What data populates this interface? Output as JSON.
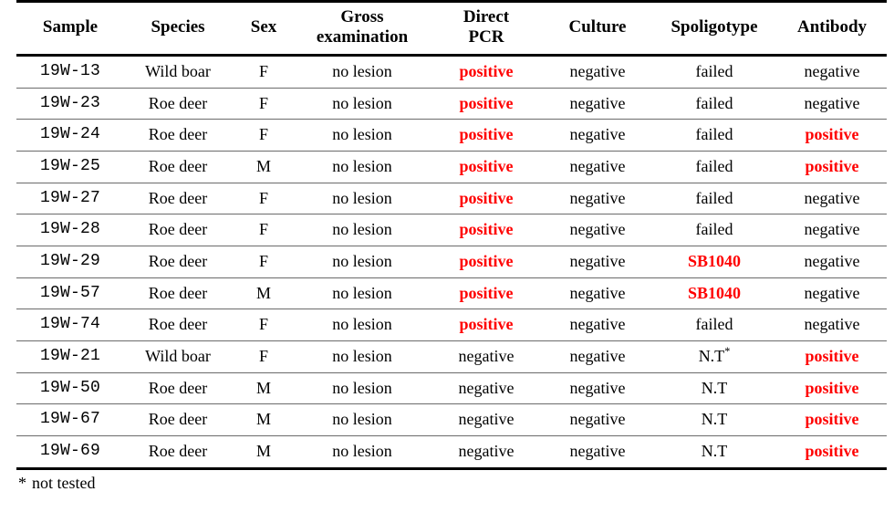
{
  "table": {
    "columns": [
      {
        "key": "sample",
        "label": "Sample",
        "label_line1": "Sample",
        "label_line2": ""
      },
      {
        "key": "species",
        "label": "Species",
        "label_line1": "Species",
        "label_line2": ""
      },
      {
        "key": "sex",
        "label": "Sex",
        "label_line1": "Sex",
        "label_line2": ""
      },
      {
        "key": "gross",
        "label": "Gross examination",
        "label_line1": "Gross",
        "label_line2": "examination"
      },
      {
        "key": "pcr",
        "label": "Direct PCR",
        "label_line1": "Direct",
        "label_line2": "PCR"
      },
      {
        "key": "culture",
        "label": "Culture",
        "label_line1": "Culture",
        "label_line2": ""
      },
      {
        "key": "spoligotype",
        "label": "Spoligotype",
        "label_line1": "Spoligotype",
        "label_line2": ""
      },
      {
        "key": "antibody",
        "label": "Antibody",
        "label_line1": "Antibody",
        "label_line2": ""
      }
    ],
    "rows": [
      {
        "sample": "19W-13",
        "species": "Wild boar",
        "sex": "F",
        "gross": "no lesion",
        "pcr": "positive",
        "culture": "negative",
        "spoligotype": "failed",
        "antibody": "negative"
      },
      {
        "sample": "19W-23",
        "species": "Roe deer",
        "sex": "F",
        "gross": "no lesion",
        "pcr": "positive",
        "culture": "negative",
        "spoligotype": "failed",
        "antibody": "negative"
      },
      {
        "sample": "19W-24",
        "species": "Roe deer",
        "sex": "F",
        "gross": "no lesion",
        "pcr": "positive",
        "culture": "negative",
        "spoligotype": "failed",
        "antibody": "positive"
      },
      {
        "sample": "19W-25",
        "species": "Roe deer",
        "sex": "M",
        "gross": "no lesion",
        "pcr": "positive",
        "culture": "negative",
        "spoligotype": "failed",
        "antibody": "positive"
      },
      {
        "sample": "19W-27",
        "species": "Roe deer",
        "sex": "F",
        "gross": "no lesion",
        "pcr": "positive",
        "culture": "negative",
        "spoligotype": "failed",
        "antibody": "negative"
      },
      {
        "sample": "19W-28",
        "species": "Roe deer",
        "sex": "F",
        "gross": "no lesion",
        "pcr": "positive",
        "culture": "negative",
        "spoligotype": "failed",
        "antibody": "negative"
      },
      {
        "sample": "19W-29",
        "species": "Roe deer",
        "sex": "F",
        "gross": "no lesion",
        "pcr": "positive",
        "culture": "negative",
        "spoligotype": "SB1040",
        "antibody": "negative"
      },
      {
        "sample": "19W-57",
        "species": "Roe deer",
        "sex": "M",
        "gross": "no lesion",
        "pcr": "positive",
        "culture": "negative",
        "spoligotype": "SB1040",
        "antibody": "negative"
      },
      {
        "sample": "19W-74",
        "species": "Roe deer",
        "sex": "F",
        "gross": "no lesion",
        "pcr": "positive",
        "culture": "negative",
        "spoligotype": "failed",
        "antibody": "negative"
      },
      {
        "sample": "19W-21",
        "species": "Wild boar",
        "sex": "F",
        "gross": "no lesion",
        "pcr": "negative",
        "culture": "negative",
        "spoligotype": "N.T",
        "spoligotype_footnote": "*",
        "antibody": "positive"
      },
      {
        "sample": "19W-50",
        "species": "Roe deer",
        "sex": "M",
        "gross": "no lesion",
        "pcr": "negative",
        "culture": "negative",
        "spoligotype": "N.T",
        "antibody": "positive"
      },
      {
        "sample": "19W-67",
        "species": "Roe deer",
        "sex": "M",
        "gross": "no lesion",
        "pcr": "negative",
        "culture": "negative",
        "spoligotype": "N.T",
        "antibody": "positive"
      },
      {
        "sample": "19W-69",
        "species": "Roe deer",
        "sex": "M",
        "gross": "no lesion",
        "pcr": "negative",
        "culture": "negative",
        "spoligotype": "N.T",
        "antibody": "positive"
      }
    ],
    "highlight_color": "#ff0000",
    "highlighted_values": [
      "positive",
      "SB1040"
    ]
  },
  "footnote": {
    "marker": "*",
    "text": "not tested"
  }
}
